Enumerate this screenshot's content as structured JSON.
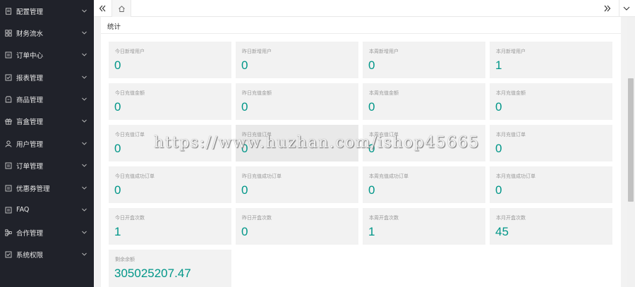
{
  "sidebar": {
    "items": [
      {
        "label": "配置管理",
        "icon": "document-icon"
      },
      {
        "label": "财务流水",
        "icon": "grid-icon"
      },
      {
        "label": "订单中心",
        "icon": "list-icon"
      },
      {
        "label": "报表管理",
        "icon": "check-square-icon"
      },
      {
        "label": "商品管理",
        "icon": "box-icon"
      },
      {
        "label": "盲盒管理",
        "icon": "gift-icon"
      },
      {
        "label": "用户管理",
        "icon": "user-icon"
      },
      {
        "label": "订单管理",
        "icon": "list-icon"
      },
      {
        "label": "优惠券管理",
        "icon": "list-icon"
      },
      {
        "label": "FAQ",
        "icon": "list-icon"
      },
      {
        "label": "合作管理",
        "icon": "network-icon"
      },
      {
        "label": "系统权限",
        "icon": "check-square-icon"
      }
    ]
  },
  "card": {
    "title": "统计"
  },
  "stats": [
    {
      "label": "今日新增用户",
      "value": "0"
    },
    {
      "label": "昨日新增用户",
      "value": "0"
    },
    {
      "label": "本周新增用户",
      "value": "0"
    },
    {
      "label": "本月新增用户",
      "value": "1"
    },
    {
      "label": "今日充值金额",
      "value": "0"
    },
    {
      "label": "昨日充值金额",
      "value": "0"
    },
    {
      "label": "本周充值金额",
      "value": "0"
    },
    {
      "label": "本月充值金额",
      "value": "0"
    },
    {
      "label": "今日充值订单",
      "value": "0"
    },
    {
      "label": "昨日充值订单",
      "value": "0"
    },
    {
      "label": "本周充值订单",
      "value": "0"
    },
    {
      "label": "本月充值订单",
      "value": "0"
    },
    {
      "label": "今日充值成功订单",
      "value": "0"
    },
    {
      "label": "昨日充值成功订单",
      "value": "0"
    },
    {
      "label": "本周充值成功订单",
      "value": "0"
    },
    {
      "label": "本月充值成功订单",
      "value": "0"
    },
    {
      "label": "今日开盒次数",
      "value": "1"
    },
    {
      "label": "昨日开盒次数",
      "value": "0"
    },
    {
      "label": "本周开盒次数",
      "value": "1"
    },
    {
      "label": "本月开盒次数",
      "value": "45"
    },
    {
      "label": "剩余余额",
      "value": "305025207.47"
    }
  ],
  "watermark": "https://www.huzhan.com/ishop45665",
  "colors": {
    "sidebar_bg": "#20222a",
    "accent_value": "#009688",
    "tile_bg": "#f2f2f2"
  }
}
